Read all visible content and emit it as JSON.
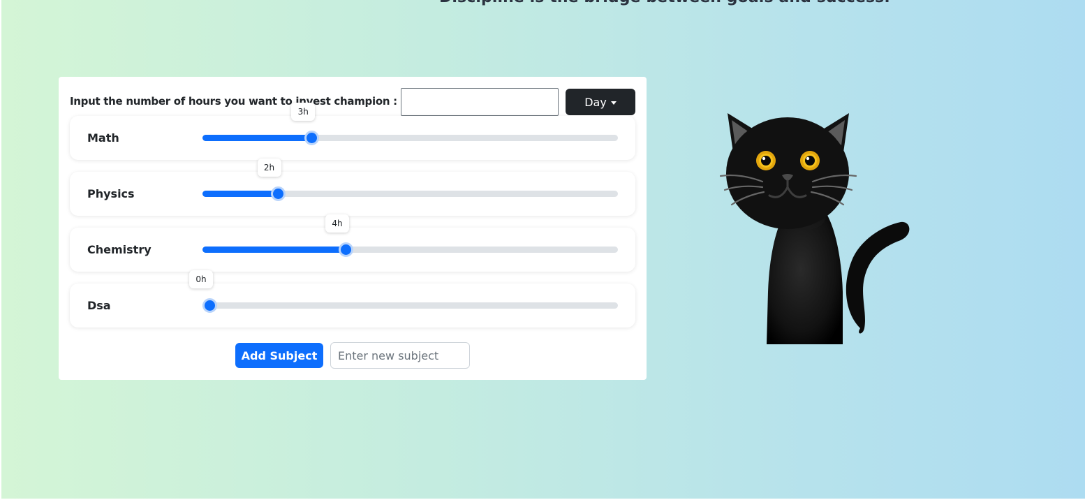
{
  "header": {
    "quote": "Discipline is the bridge between goals and success."
  },
  "planner": {
    "prompt_label": "Input the number of hours you want to invest champion :",
    "hours_input_value": "",
    "period_dropdown": {
      "selected": "Day",
      "icon": "caret-down-icon"
    },
    "slider_max_hours": 12,
    "subjects": [
      {
        "name": "Math",
        "hours": 3,
        "hours_label": "3h"
      },
      {
        "name": "Physics",
        "hours": 2,
        "hours_label": "2h"
      },
      {
        "name": "Chemistry",
        "hours": 4,
        "hours_label": "4h"
      },
      {
        "name": "Dsa",
        "hours": 0,
        "hours_label": "0h"
      }
    ],
    "add_subject_button": "Add Subject",
    "new_subject_placeholder": "Enter new subject",
    "new_subject_value": ""
  },
  "illustration": {
    "icon": "black-cat-illustration"
  },
  "colors": {
    "accent": "#0d6efd",
    "dark_button": "#212529",
    "track": "#dee2e6",
    "bg_left": "#d4f5d6",
    "bg_right": "#addcf1"
  }
}
